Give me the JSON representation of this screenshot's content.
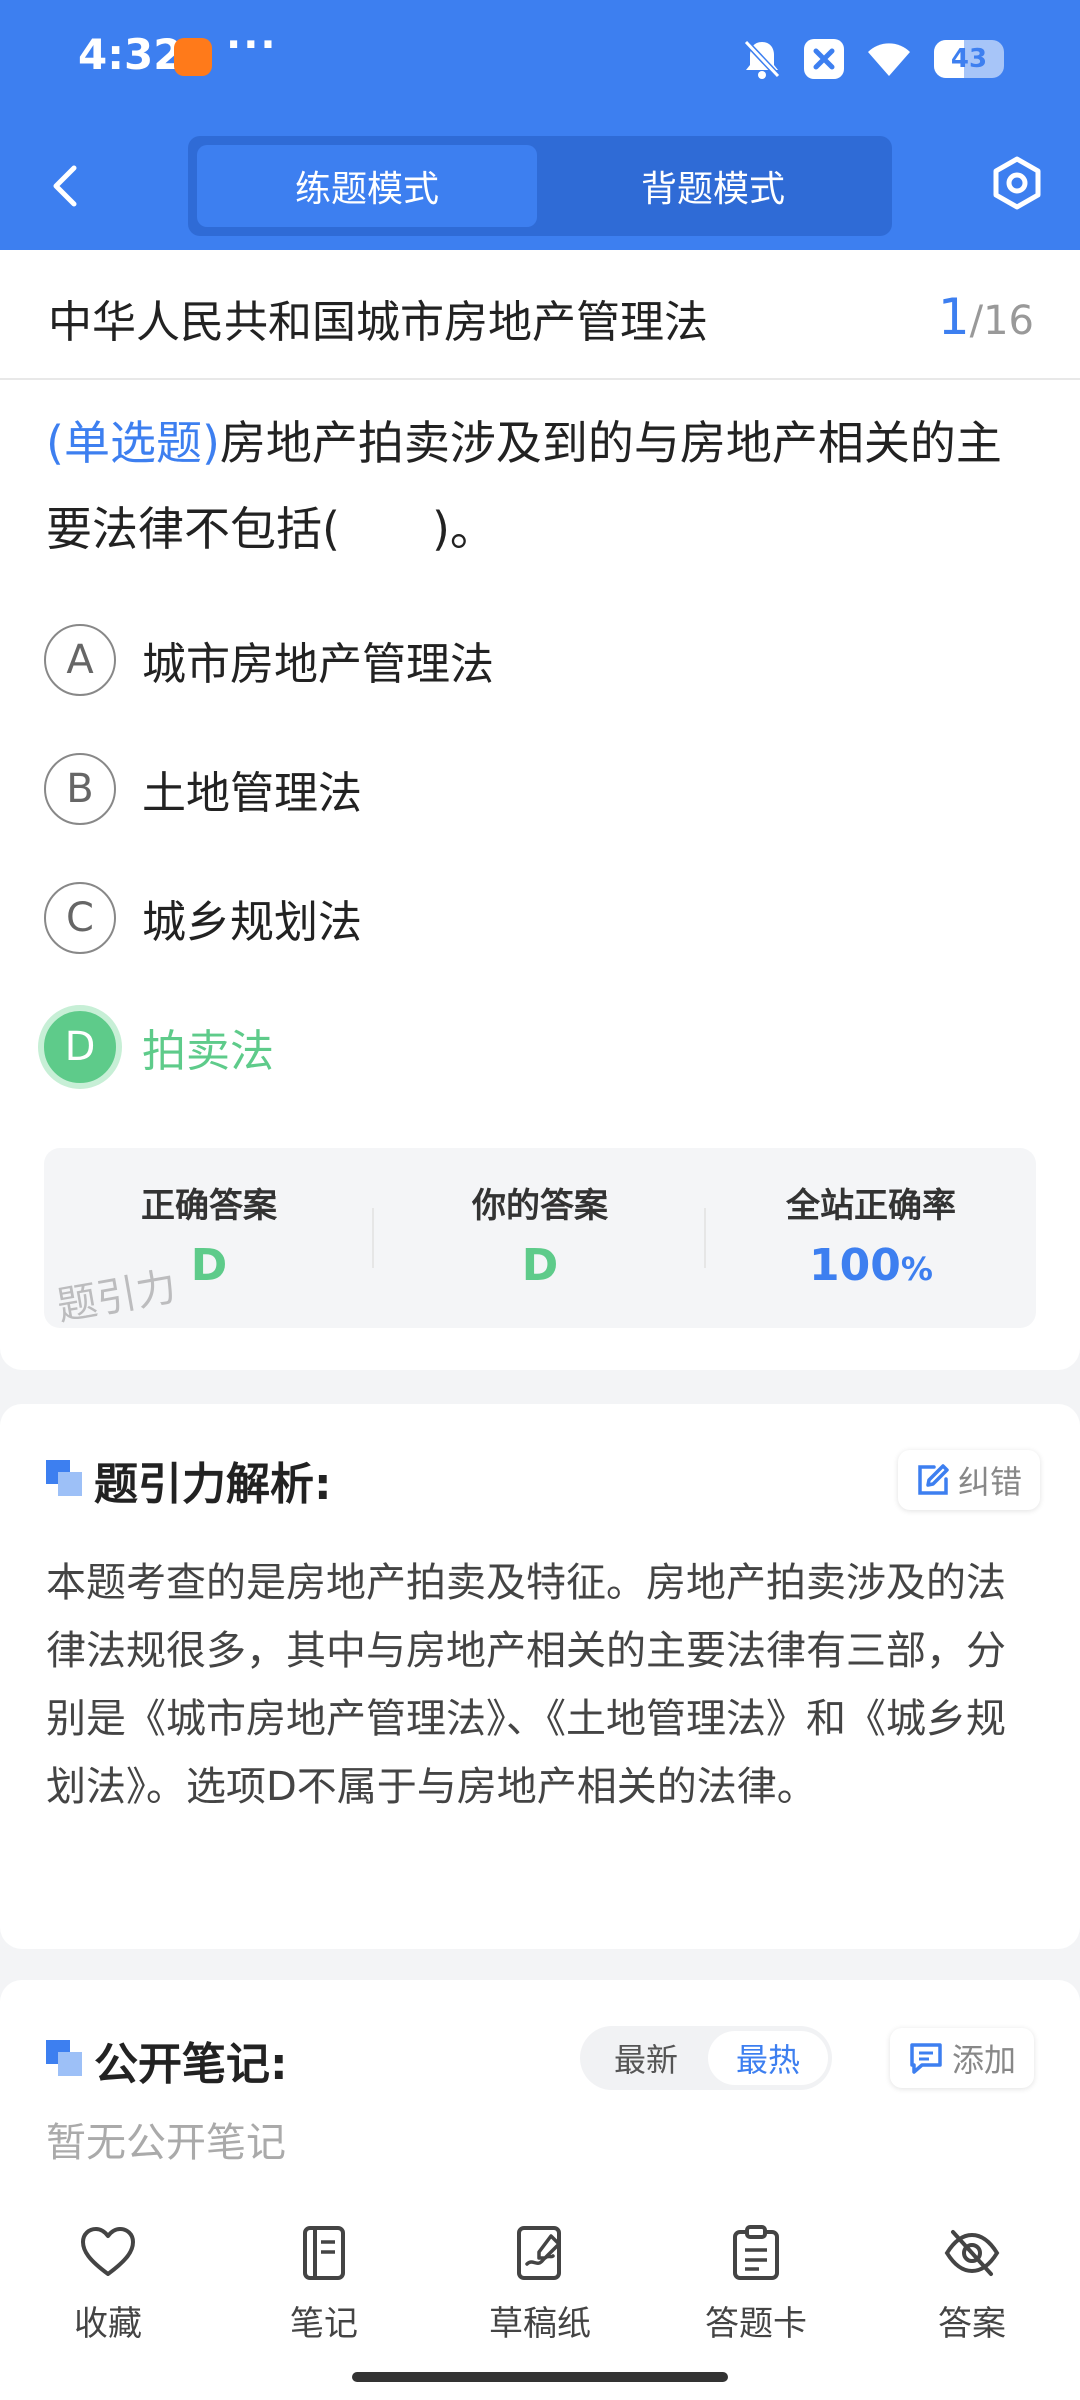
{
  "status_bar": {
    "time": "4:32",
    "dots": "···",
    "battery": "43",
    "battery_level": 0.43
  },
  "header": {
    "mode_tabs": [
      {
        "label": "练题模式",
        "active": true
      },
      {
        "label": "背题模式",
        "active": false
      }
    ]
  },
  "question": {
    "chapter_title": "中华人民共和国城市房地产管理法",
    "current": "1",
    "total": "/16",
    "type": "(单选题)",
    "text": "房地产拍卖涉及到的与房地产相关的主要法律不包括(　　)。",
    "options": [
      {
        "letter": "A",
        "text": "城市房地产管理法"
      },
      {
        "letter": "B",
        "text": "土地管理法"
      },
      {
        "letter": "C",
        "text": "城乡规划法"
      },
      {
        "letter": "D",
        "text": "拍卖法",
        "correct": true
      }
    ]
  },
  "answer_summary": {
    "correct_label": "正确答案",
    "correct_value": "D",
    "yours_label": "你的答案",
    "yours_value": "D",
    "rate_label": "全站正确率",
    "rate_value": "100",
    "rate_unit": "%",
    "watermark": "题引力"
  },
  "analysis": {
    "title": "题引力解析:",
    "report_label": "纠错",
    "text": "本题考查的是房地产拍卖及特征。房地产拍卖涉及的法律法规很多，其中与房地产相关的主要法律有三部，分别是《城市房地产管理法》、《土地管理法》和《城乡规划法》。选项D不属于与房地产相关的法律。"
  },
  "notes": {
    "title": "公开笔记:",
    "sort_latest": "最新",
    "sort_hot": "最热",
    "add_label": "添加",
    "empty_text": "暂无公开笔记"
  },
  "bottom_tabs": [
    {
      "label": "收藏",
      "icon": "heart-icon"
    },
    {
      "label": "笔记",
      "icon": "notebook-icon"
    },
    {
      "label": "草稿纸",
      "icon": "draft-icon"
    },
    {
      "label": "答题卡",
      "icon": "answer-card-icon"
    },
    {
      "label": "答案",
      "icon": "eye-off-icon"
    }
  ],
  "colors": {
    "primary": "#3d7ff0",
    "correct": "#5ecb8a",
    "background": "#f3f4f6"
  }
}
